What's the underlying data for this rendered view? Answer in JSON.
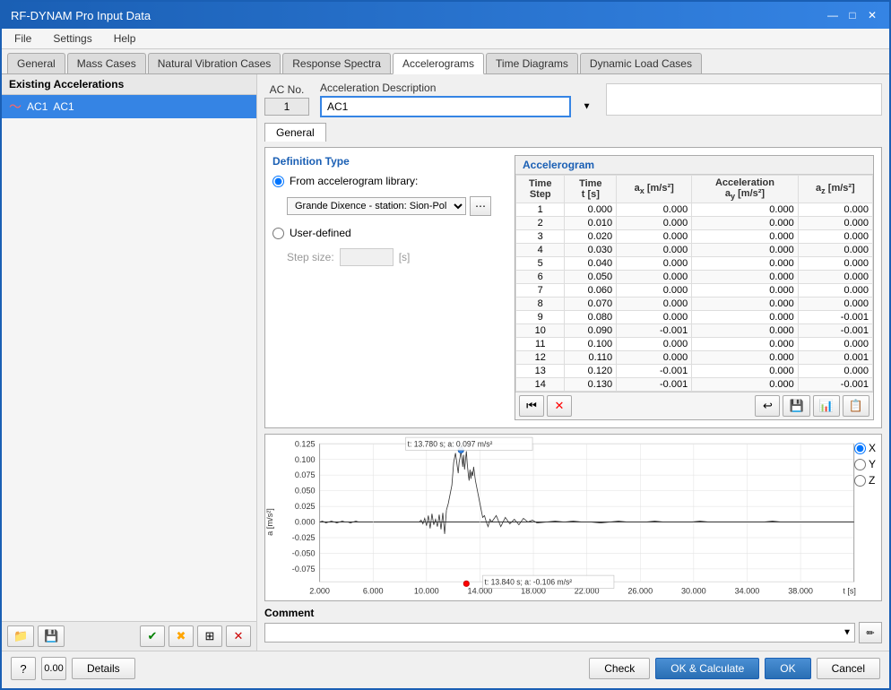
{
  "window": {
    "title": "RF-DYNAM Pro Input Data"
  },
  "menu": {
    "items": [
      "File",
      "Settings",
      "Help"
    ]
  },
  "tabs": [
    {
      "label": "General",
      "active": false
    },
    {
      "label": "Mass Cases",
      "active": false
    },
    {
      "label": "Natural Vibration Cases",
      "active": false
    },
    {
      "label": "Response Spectra",
      "active": false
    },
    {
      "label": "Accelerograms",
      "active": true
    },
    {
      "label": "Time Diagrams",
      "active": false
    },
    {
      "label": "Dynamic Load Cases",
      "active": false
    }
  ],
  "left_panel": {
    "title": "Existing Accelerations",
    "items": [
      {
        "id": "AC1",
        "label": "AC1",
        "selected": true
      }
    ]
  },
  "ac_header": {
    "no_label": "AC No.",
    "no_value": "1",
    "desc_label": "Acceleration Description",
    "desc_value": "AC1"
  },
  "section_tab": "General",
  "definition_type": {
    "title": "Definition Type",
    "options": [
      {
        "label": "From accelerogram library:",
        "selected": true
      },
      {
        "label": "User-defined",
        "selected": false
      }
    ],
    "library_value": "Grande Dixence - station: Sion-Police Cantonal",
    "step_label": "Step size:",
    "step_unit": "[s]"
  },
  "accelerogram_table": {
    "title": "Accelerogram",
    "columns": [
      "Time Step",
      "Time\nt [s]",
      "ax [m/s²]",
      "Acceleration\nay [m/s²]",
      "az [m/s²]"
    ],
    "col_headers": [
      {
        "line1": "Time",
        "line2": "Step"
      },
      {
        "line1": "Time",
        "line2": "t [s]"
      },
      {
        "line1": "ax [m/s²]",
        "line2": ""
      },
      {
        "line1": "Acceleration",
        "line2": "ay [m/s²]"
      },
      {
        "line1": "az [m/s²]",
        "line2": ""
      }
    ],
    "rows": [
      [
        1,
        0.0,
        0.0,
        -0.0,
        -0.0
      ],
      [
        2,
        0.01,
        0.0,
        -0.0,
        -0.0
      ],
      [
        3,
        0.02,
        0.0,
        -0.0,
        -0.0
      ],
      [
        4,
        0.03,
        0.0,
        -0.0,
        -0.0
      ],
      [
        5,
        0.04,
        -0.0,
        -0.0,
        -0.0
      ],
      [
        6,
        0.05,
        0.0,
        -0.0,
        0.0
      ],
      [
        7,
        0.06,
        0.0,
        -0.0,
        0.0
      ],
      [
        8,
        0.07,
        0.0,
        -0.0,
        0.0
      ],
      [
        9,
        0.08,
        -0.0,
        -0.0,
        -0.001
      ],
      [
        10,
        0.09,
        -0.001,
        -0.0,
        -0.001
      ],
      [
        11,
        0.1,
        -0.0,
        0.0,
        0.0
      ],
      [
        12,
        0.11,
        -0.0,
        -0.0,
        0.001
      ],
      [
        13,
        0.12,
        -0.001,
        -0.0,
        0.0
      ],
      [
        14,
        0.13,
        -0.001,
        -0.0,
        -0.001
      ]
    ]
  },
  "chart": {
    "tooltip_max": "t: 13.780 s; a: 0.097 m/s²",
    "tooltip_min": "t: 13.840 s; a: -0.106 m/s²",
    "y_label": "a [m/s²]",
    "x_label": "t [s]",
    "y_ticks": [
      "0.125",
      "0.100",
      "0.075",
      "0.050",
      "0.025",
      "0.000",
      "-0.025",
      "-0.050",
      "-0.075"
    ],
    "x_ticks": [
      "2.000",
      "6.000",
      "10.000",
      "14.000",
      "18.000",
      "22.000",
      "26.000",
      "30.000",
      "34.000",
      "38.000"
    ],
    "axis_options": [
      "X",
      "Y",
      "Z"
    ]
  },
  "comment": {
    "label": "Comment",
    "value": ""
  },
  "bottom_bar": {
    "check_label": "Check",
    "ok_calc_label": "OK & Calculate",
    "ok_label": "OK",
    "cancel_label": "Cancel",
    "details_label": "Details"
  }
}
